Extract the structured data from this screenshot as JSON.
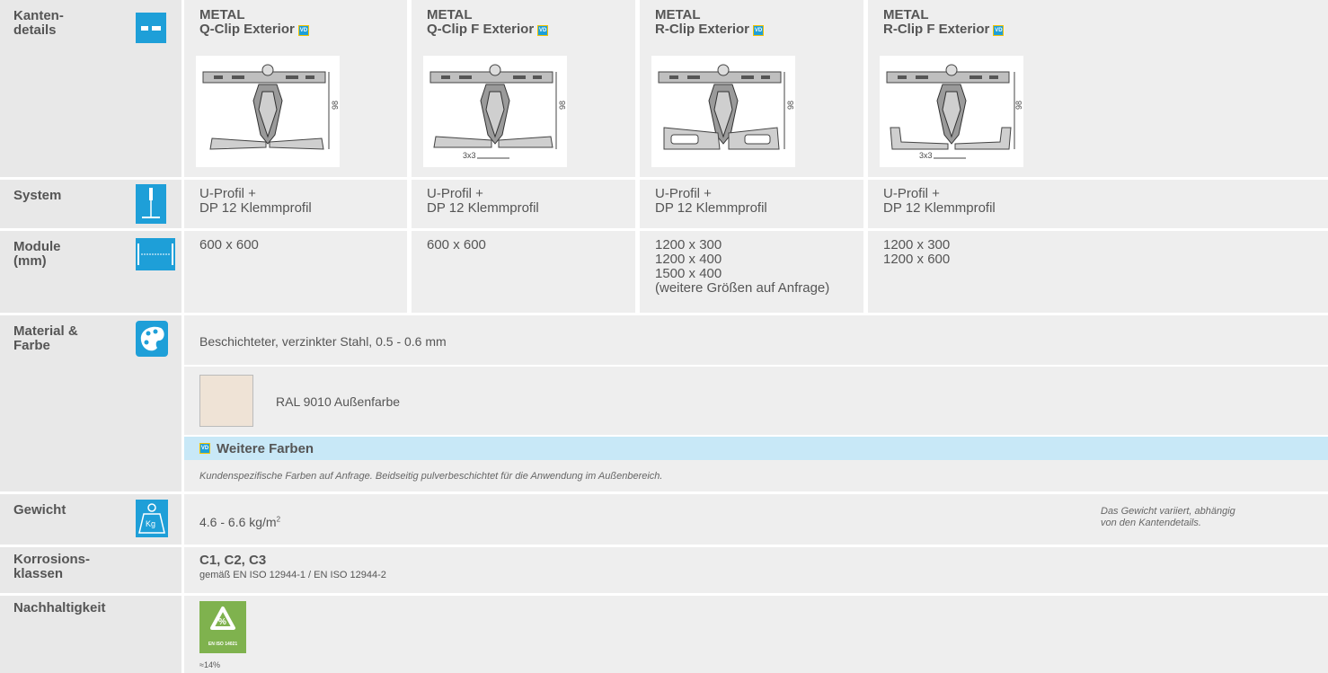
{
  "rows": {
    "kanten": {
      "label": "Kanten-\ndetails"
    },
    "system": {
      "label": "System"
    },
    "module": {
      "label": "Module\n(mm)"
    },
    "material": {
      "label": "Material &\nFarbe"
    },
    "gewicht": {
      "label": "Gewicht"
    },
    "korrosion": {
      "label": "Korrosions-\nklassen"
    },
    "nachhaltigkeit": {
      "label": "Nachhaltigkeit"
    }
  },
  "products": [
    {
      "brand": "METAL",
      "name": "Q-Clip Exterior",
      "badge": "VD",
      "dimension": "98",
      "detail": "",
      "system": "U-Profil +\nDP 12 Klemmprofil",
      "modules": "600 x 600"
    },
    {
      "brand": "METAL",
      "name": "Q-Clip F Exterior",
      "badge": "VD",
      "dimension": "98",
      "detail": "3x3",
      "system": "U-Profil +\nDP 12 Klemmprofil",
      "modules": "600 x 600"
    },
    {
      "brand": "METAL",
      "name": "R-Clip Exterior",
      "badge": "VD",
      "dimension": "98",
      "detail": "",
      "system": "U-Profil +\nDP 12 Klemmprofil",
      "modules": "1200 x 300\n1200 x 400\n1500 x 400\n(weitere Größen auf Anfrage)"
    },
    {
      "brand": "METAL",
      "name": "R-Clip F Exterior",
      "badge": "VD",
      "dimension": "98",
      "detail": "3x3",
      "system": "U-Profil +\nDP 12 Klemmprofil",
      "modules": "1200 x 300\n1200 x 600"
    }
  ],
  "material": {
    "description": "Beschichteter, verzinkter Stahl, 0.5 - 0.6 mm",
    "color_name": "RAL 9010 Außenfarbe",
    "swatch_color": "#efe3d6",
    "more_colors_badge": "VD",
    "more_colors_title": "Weitere Farben",
    "more_colors_note": "Kundenspezifische Farben auf Anfrage. Beidseitig pulverbeschichtet für die Anwendung im Außenbereich."
  },
  "weight": {
    "value": "4.6 - 6.6 kg/m",
    "unit_sup": "2",
    "note": "Das Gewicht variiert, abhängig von den Kantendetails.",
    "icon_text": "Kg"
  },
  "corrosion": {
    "classes": "C1, C2, C3",
    "standard": "gemäß EN ISO 12944-1 / EN ISO 12944-2"
  },
  "sustainability": {
    "badge_symbol": "%",
    "badge_text": "EN ISO 14021",
    "value": "≈14%",
    "badge_color": "#7fb24e"
  },
  "colors": {
    "accent": "#1e9fd8",
    "label_bg": "#e8e8e8",
    "cell_bg": "#eeeeee",
    "banner_bg": "#c8e8f7"
  }
}
